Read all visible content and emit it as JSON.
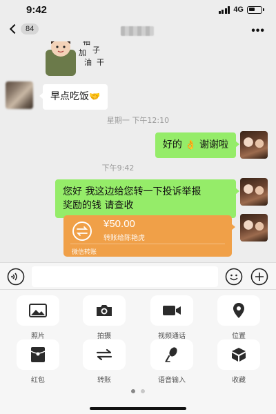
{
  "status_bar": {
    "time": "9:42",
    "network": "4G",
    "signal_level": 4
  },
  "nav": {
    "unread_count": "84",
    "more_icon": "ellipsis-icon"
  },
  "messages": {
    "sticker_text": "加油 袖子 干",
    "m1_text": "早点吃饭",
    "m1_emoji": "🤝",
    "ts1": "星期一 下午12:10",
    "m2_text_a": "好的",
    "m2_emoji": "👌",
    "m2_text_b": "谢谢啦",
    "ts2": "下午9:42",
    "m3_line1": "您好 我这边给您转一下投诉举报",
    "m3_line2": "奖励的钱 请查收"
  },
  "transfer": {
    "amount": "¥50.00",
    "description": "转账给陈艳虎",
    "footer": "微信转账",
    "color": "#f0a048"
  },
  "input_bar": {
    "placeholder": ""
  },
  "panel": {
    "items": [
      {
        "label": "照片",
        "icon": "photo-icon"
      },
      {
        "label": "拍摄",
        "icon": "camera-icon"
      },
      {
        "label": "视频通话",
        "icon": "video-call-icon"
      },
      {
        "label": "位置",
        "icon": "location-icon"
      },
      {
        "label": "红包",
        "icon": "red-packet-icon"
      },
      {
        "label": "转账",
        "icon": "transfer-icon"
      },
      {
        "label": "语音输入",
        "icon": "microphone-icon"
      },
      {
        "label": "收藏",
        "icon": "favorites-icon"
      }
    ],
    "page_count": 2,
    "current_page": 1
  },
  "colors": {
    "background": "#ededed",
    "bubble_sent": "#95ec69",
    "bubble_received": "#ffffff"
  }
}
